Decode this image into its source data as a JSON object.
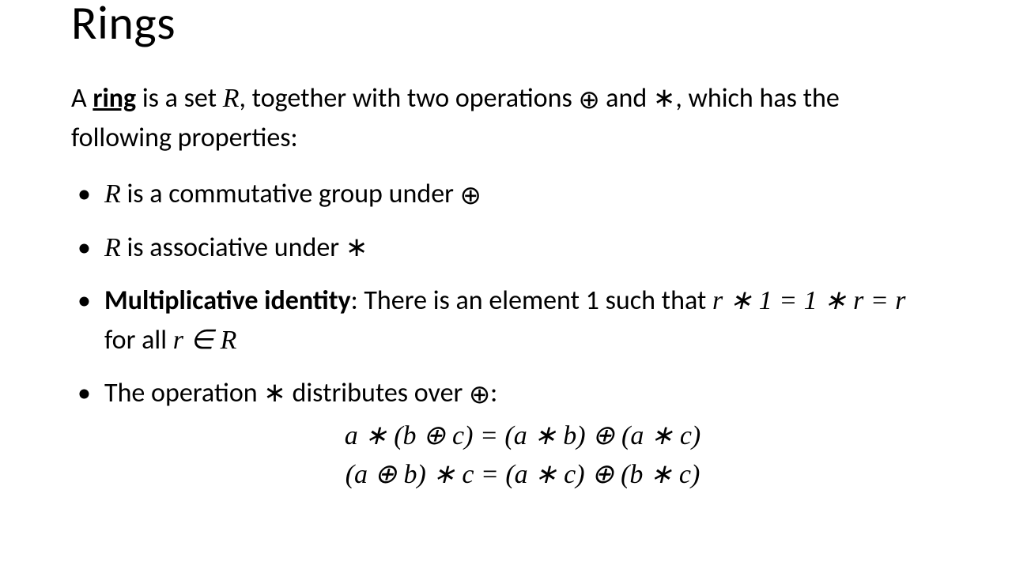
{
  "slide": {
    "title": "Rings",
    "intro": {
      "prefix": "A ",
      "term": "ring",
      "mid1": " is a set ",
      "R": "R",
      "mid2": ", together with two operations ",
      "op1": "⊕",
      "mid3": " and ",
      "op2": "∗",
      "suffix": ", which has the following properties:"
    },
    "bullets": {
      "b1": {
        "R": "R",
        "text1": " is a commutative group under ",
        "op": "⊕"
      },
      "b2": {
        "R": "R",
        "text1": " is associative under ",
        "op": "∗"
      },
      "b3": {
        "label": "Multiplicative identity",
        "colon": ": There is an element 1 such that ",
        "eq": "r ∗ 1 = 1 ∗ r = r",
        "forall": " for all ",
        "rinR": "r ∈ R"
      },
      "b4": {
        "text1": "The operation ",
        "op1": "∗",
        "text2": " distributes over ",
        "op2": "⊕",
        "colon": ":"
      }
    },
    "equations": {
      "line1": "a ∗ (b ⊕ c) = (a ∗ b) ⊕ (a ∗ c)",
      "line2": "(a ⊕ b) ∗ c = (a ∗ c) ⊕ (b ∗ c)"
    }
  }
}
